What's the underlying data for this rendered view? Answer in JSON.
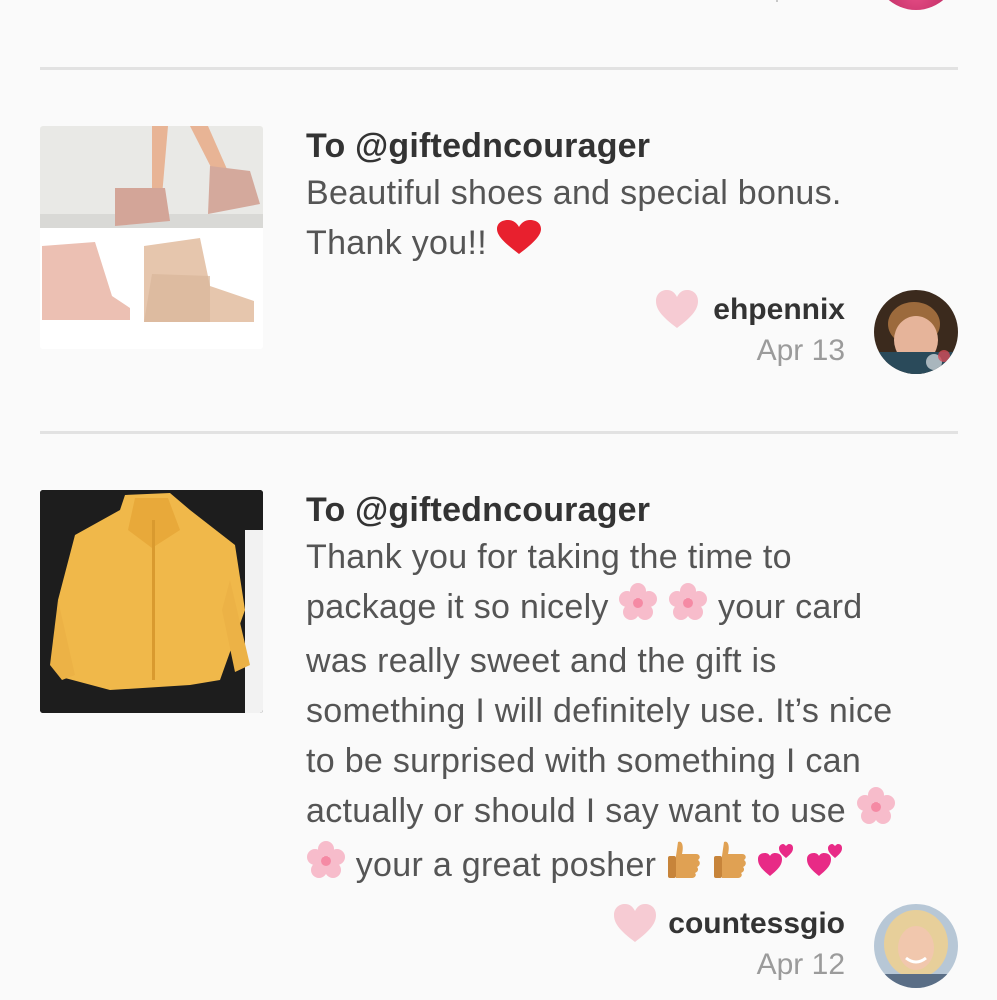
{
  "reviews": [
    {
      "to": "To @giftedncourager",
      "message_line1": "Beautiful shoes and special bonus.",
      "message_line2": "Thank you!!",
      "username": "ehpennix",
      "date": "Apr 13",
      "photo": "sneakers-photo",
      "emoji": [
        "red-heart"
      ]
    },
    {
      "to": "To @giftedncourager",
      "msg": {
        "l1": "Thank you for taking the time to",
        "l2a": "package it so nicely",
        "l2b": "your card",
        "l3": "was really sweet and the gift is",
        "l4": "something I will definitely use. It’s nice",
        "l5": "to be surprised with something I can",
        "l6": "actually or should I say want to use",
        "l7": "your a great posher"
      },
      "username": "countessgio",
      "date": "Apr 12",
      "photo": "yellow-hoodie-photo",
      "emoji": [
        "cherry-blossom",
        "thumbs-up",
        "two-hearts"
      ]
    }
  ],
  "colors": {
    "like_heart": "#f6cbd3",
    "divider": "#e2e2e2",
    "red_heart": "#e8202e"
  }
}
